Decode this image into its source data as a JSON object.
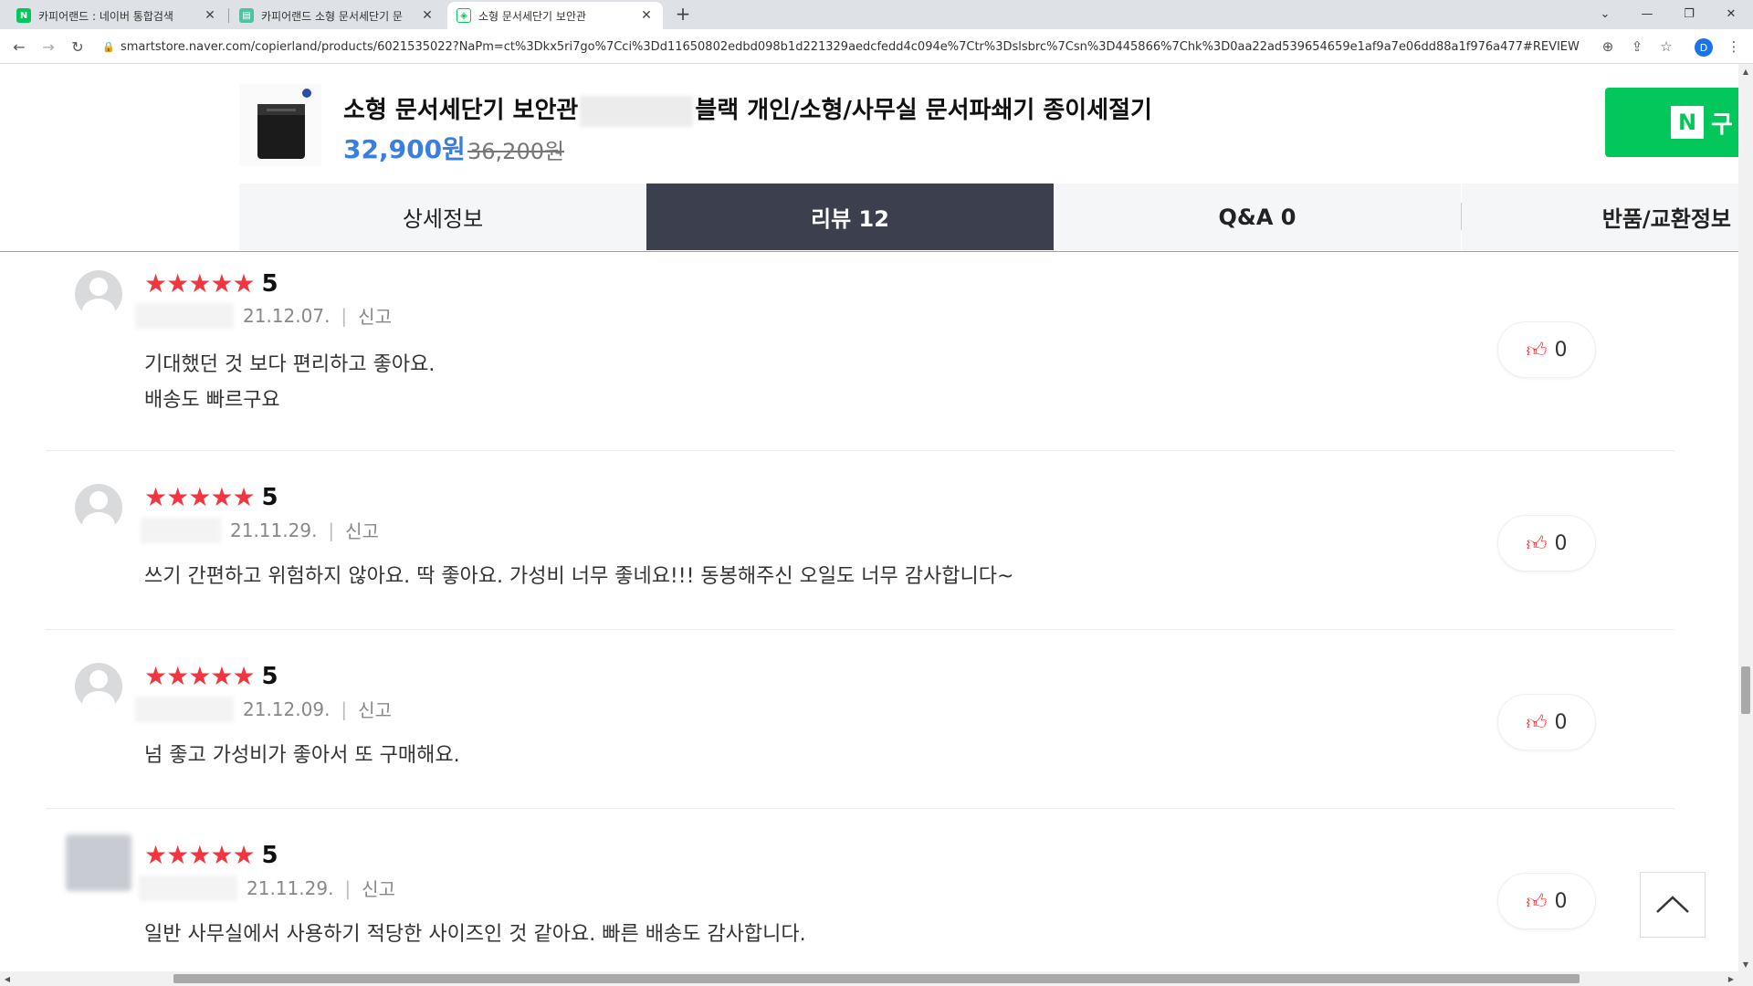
{
  "browser": {
    "tabs": [
      {
        "title": "카피어랜드 : 네이버 통합검색",
        "favicon": "naver-n-icon",
        "active": false
      },
      {
        "title": "카피어랜드 소형 문서세단기 문",
        "favicon": "smartstore-icon",
        "active": false
      },
      {
        "title": "소형 문서세단기 보안관",
        "favicon": "security-shield-icon",
        "active": true
      }
    ],
    "new_tab": "+",
    "url": "smartstore.naver.com/copierland/products/6021535022?NaPm=ct%3Dkx5ri7go%7Cci%3Dd11650802edbd098b1d221329aedcfedd4c094e%7Ctr%3Dslsbrc%7Csn%3D445866%7Chk%3D0aa22ad539654659e1af9a7e06dd88a1f976a477#REVIEW",
    "profile_initial": "D"
  },
  "product": {
    "title_part1": "소형 문서세단기 보안관",
    "title_part2": "블랙 개인/소형/사무실 문서파쇄기 종이세절기",
    "price": "32,900원",
    "original_price": "36,200원",
    "buy_label": "구",
    "buy_logo": "N"
  },
  "tabs_nav": {
    "detail": "상세정보",
    "review": "리뷰 12",
    "qna": "Q&A 0",
    "return": "반품/교환정보"
  },
  "reviews": [
    {
      "score": "5",
      "date": "21.12.07.",
      "report": "신고",
      "text": "기대했던 것 보다 편리하고 좋아요.\n배송도 빠르구요",
      "likes": "0",
      "avatar": "default"
    },
    {
      "score": "5",
      "date": "21.11.29.",
      "report": "신고",
      "text": "쓰기 간편하고 위험하지 않아요. 딱 좋아요. 가성비 너무 좋네요!!!  동봉해주신 오일도 너무 감사합니다~",
      "likes": "0",
      "avatar": "default"
    },
    {
      "score": "5",
      "date": "21.12.09.",
      "report": "신고",
      "text": "넘 좋고 가성비가 좋아서 또 구매해요.",
      "likes": "0",
      "avatar": "default"
    },
    {
      "score": "5",
      "date": "21.11.29.",
      "report": "신고",
      "text": "일반 사무실에서 사용하기 적당한 사이즈인 것 같아요. 빠른 배송도 감사합니다.",
      "likes": "0",
      "avatar": "photo"
    }
  ],
  "colors": {
    "star": "#f2363f",
    "price": "#3a7ee0",
    "active_tab": "#3c3f4e",
    "buy_button": "#03c75a"
  }
}
